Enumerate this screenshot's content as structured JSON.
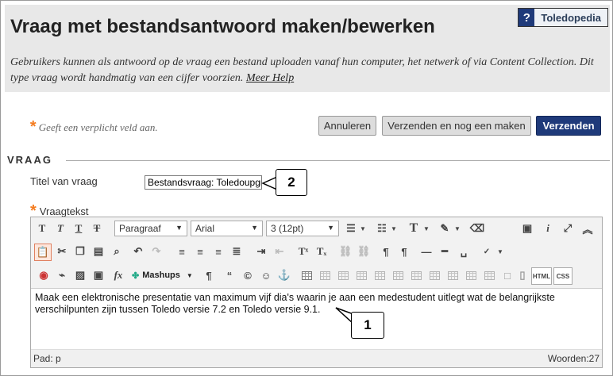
{
  "header": {
    "title": "Vraag met bestandsantwoord maken/bewerken",
    "help_badge_icon": "?",
    "help_badge_label": "Toledopedia",
    "description": "Gebruikers kunnen als antwoord op de vraag een bestand uploaden vanaf hun computer, het netwerk of via Content Collection. Dit type vraag wordt handmatig van een cijfer voorzien.",
    "help_link": "Meer Help"
  },
  "required_note": "Geeft een verplicht veld aan.",
  "actions": {
    "cancel": "Annuleren",
    "submit_and_new": "Verzenden en nog een maken",
    "submit": "Verzenden"
  },
  "section": {
    "title": "VRAAG",
    "title_label": "Titel van vraag",
    "title_value": "Bestandsvraag:  Toledoupgr",
    "question_label": "Vraagtekst"
  },
  "editor": {
    "format_select": "Paragraaf",
    "font_select": "Arial",
    "size_select": "3 (12pt)",
    "mashups_label": "Mashups",
    "html_label": "HTML",
    "css_label": "CSS",
    "content": "Maak een elektronische presentatie van maximum vijf dia's waarin je aan een medestudent uitlegt wat de belangrijkste verschilpunten zijn tussen Toledo versie 7.2 en Toledo versie 9.1.",
    "path_label": "Pad: p",
    "word_count": "Woorden:27"
  },
  "callouts": {
    "one": "1",
    "two": "2"
  },
  "colors": {
    "accent": "#1f3a7a",
    "required_star": "#f47c20",
    "header_bg": "#e8e8e8"
  }
}
